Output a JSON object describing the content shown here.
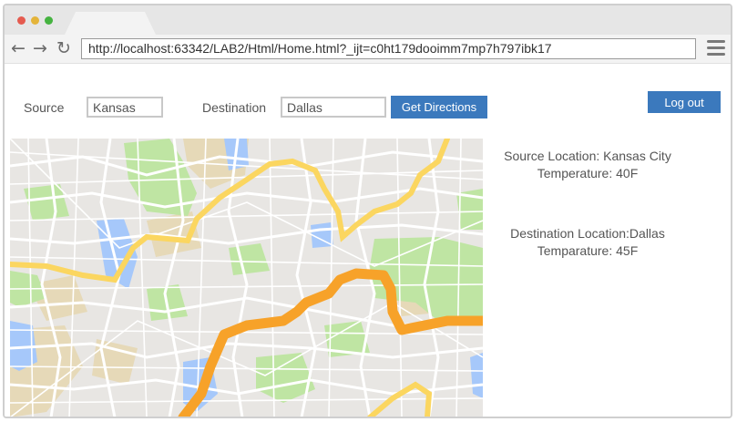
{
  "browser": {
    "url": "http://localhost:63342/LAB2/Html/Home.html?_ijt=c0ht179dooimm7mp7h797ibk17"
  },
  "form": {
    "source_label": "Source",
    "source_value": "Kansas",
    "destination_label": "Destination",
    "destination_value": "Dallas",
    "directions_button": "Get Directions"
  },
  "header": {
    "logout_button": "Log out"
  },
  "info": {
    "source_location": "Source Location: Kansas City",
    "source_temperature": "Temperature:  40F",
    "destination_location": "Destination Location:Dallas",
    "destination_temperature": "Temparature:  45F"
  },
  "colors": {
    "button": "#3b79bd",
    "route": "#f7a229",
    "road": "#fbd660",
    "park": "#bfe5a3",
    "water": "#a6c8fa"
  }
}
